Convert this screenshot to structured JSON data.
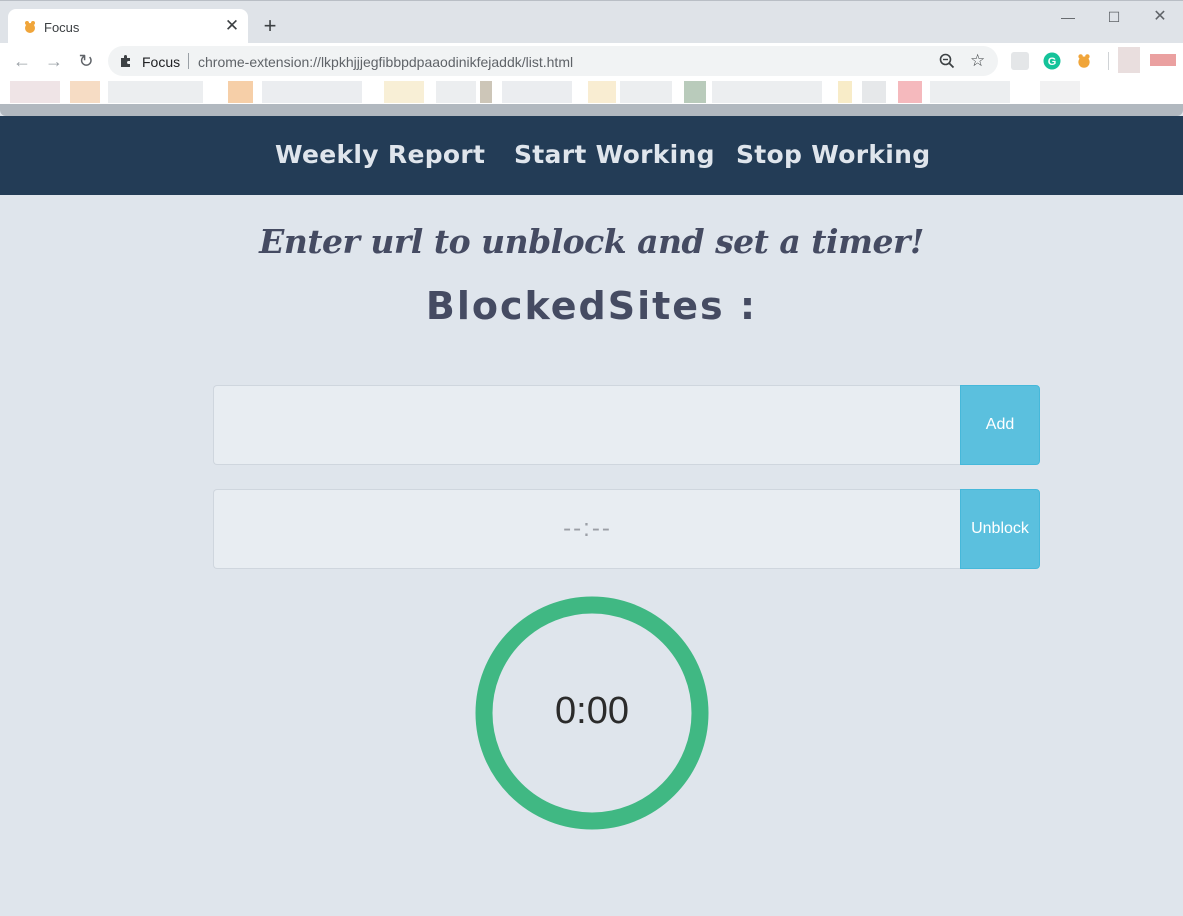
{
  "browser": {
    "tab_title": "Focus",
    "omnibox_label": "Focus",
    "url": "chrome-extension://lkpkhjjjegfibbpdpaaodinikfejaddk/list.html",
    "icons": [
      "back-icon",
      "forward-icon",
      "reload-icon",
      "extension-puzzle-icon",
      "zoom-icon",
      "star-icon",
      "grammarly-icon",
      "focus-extension-icon"
    ]
  },
  "nav": {
    "weekly_report": "Weekly Report",
    "start_working": "Start Working",
    "stop_working": "Stop Working"
  },
  "main": {
    "headline": "Enter url to unblock and set a timer!",
    "blocked_title": "BlockedSites :",
    "url_input_value": "",
    "add_label": "Add",
    "time_placeholder": "--:--",
    "unblock_label": "Unblock",
    "timer_value": "0:00"
  },
  "colors": {
    "navbar": "#233c56",
    "page_background": "#dfe5ec",
    "button_accent": "#5bc0de",
    "timer_ring": "#40b883",
    "heading_text": "#454b62"
  }
}
